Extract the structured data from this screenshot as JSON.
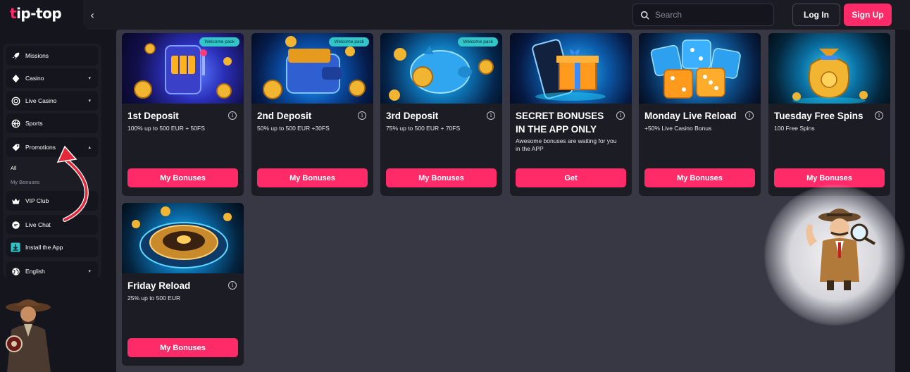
{
  "header": {
    "logo": "tip-top",
    "logo_accent": "t",
    "back_icon": "chevron-left-icon",
    "search_placeholder": "Search",
    "login_label": "Log In",
    "signup_label": "Sign Up"
  },
  "colors": {
    "accent": "#ff2a68",
    "badge": "#32c6c9",
    "card_bg": "#1c1c24",
    "main_bg": "#383845",
    "page_bg": "#15151d"
  },
  "sidebar": {
    "items": [
      {
        "label": "Missions",
        "icon": "rocket-icon"
      },
      {
        "label": "Casino",
        "icon": "diamond-icon",
        "chevron": "▾"
      },
      {
        "label": "Live Casino",
        "icon": "chip-icon",
        "chevron": "▾"
      },
      {
        "label": "Sports",
        "icon": "ball-icon"
      },
      {
        "label": "Promotions",
        "icon": "tag-icon",
        "chevron": "▴"
      },
      {
        "label": "VIP Club",
        "icon": "crown-icon"
      },
      {
        "label": "Live Chat",
        "icon": "chat-icon"
      },
      {
        "label": "Install the App",
        "icon": "download-icon"
      },
      {
        "label": "English",
        "icon": "globe-icon",
        "chevron": "▾"
      }
    ],
    "promotions_sub": [
      {
        "label": "All"
      },
      {
        "label": "My Bonuses"
      }
    ]
  },
  "promos": [
    {
      "title": "1st Deposit",
      "desc": "100% up to 500 EUR + 50FS",
      "badge": "Welcome pack",
      "cta": "My Bonuses"
    },
    {
      "title": "2nd Deposit",
      "desc": "50% up to 500 EUR +30FS",
      "badge": "Welcome pack",
      "cta": "My Bonuses"
    },
    {
      "title": "3rd Deposit",
      "desc": "75% up to 500 EUR + 70FS",
      "badge": "Welcome pack",
      "cta": "My Bonuses"
    },
    {
      "title": "SECRET BONUSES IN THE APP ONLY",
      "desc": "Awesome bonuses are waiting for you in the APP",
      "cta": "Get"
    },
    {
      "title": "Monday Live Reload",
      "desc": "+50% Live Casino Bonus",
      "cta": "My Bonuses"
    },
    {
      "title": "Tuesday Free Spins",
      "desc": "100 Free Spins",
      "cta": "My Bonuses"
    },
    {
      "title": "Friday Reload",
      "desc": "25% up to 500 EUR",
      "cta": "My Bonuses"
    }
  ],
  "info_glyph": "i"
}
